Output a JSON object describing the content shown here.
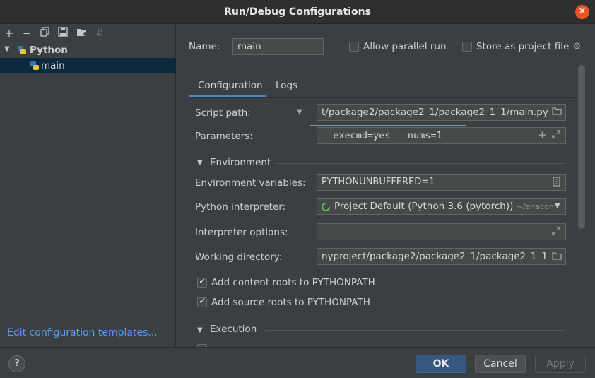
{
  "window": {
    "title": "Run/Debug Configurations"
  },
  "sidebar": {
    "toolbar": [
      "+",
      "−",
      "copy-icon",
      "save-icon",
      "folder-add-icon",
      "sort-icon"
    ],
    "group": "Python",
    "item": "main",
    "footer_link": "Edit configuration templates..."
  },
  "header": {
    "name_label": "Name:",
    "name_value": "main",
    "allow_parallel": "Allow parallel run",
    "store_project": "Store as project file"
  },
  "tabs": [
    {
      "label": "Configuration"
    },
    {
      "label": "Logs"
    }
  ],
  "config": {
    "script_path_label": "Script path:",
    "script_path_value": "t/package2/package2_1/package2_1_1/main.py",
    "parameters_label": "Parameters:",
    "parameters_value": "--execmd=yes --nums=1",
    "environment_section": "Environment",
    "env_vars_label": "Environment variables:",
    "env_vars_value": "PYTHONUNBUFFERED=1",
    "interpreter_label": "Python interpreter:",
    "interpreter_value": "Project Default (Python 3.6 (pytorch))",
    "interpreter_path": "~/anacon",
    "interp_options_label": "Interpreter options:",
    "interp_options_value": "",
    "working_dir_label": "Working directory:",
    "working_dir_value": "nyproject/package2/package2_1/package2_1_1",
    "content_roots": "Add content roots to PYTHONPATH",
    "source_roots": "Add source roots to PYTHONPATH",
    "execution_section": "Execution"
  },
  "footer": {
    "help": "?",
    "ok": "OK",
    "cancel": "Cancel",
    "apply": "Apply"
  },
  "colors": {
    "accent": "#4a88c7",
    "highlight": "#e87d2a",
    "close": "#e95420"
  }
}
